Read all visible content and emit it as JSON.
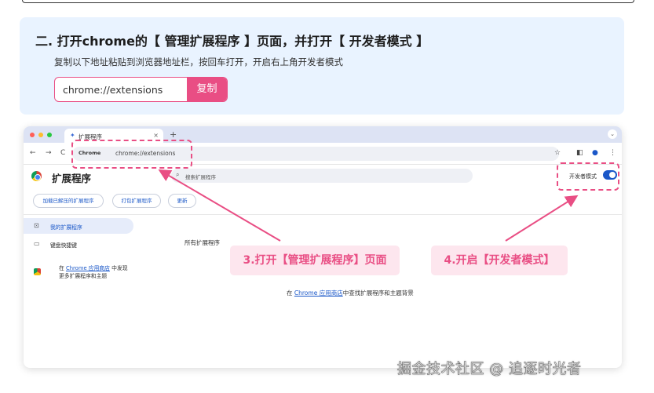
{
  "step": {
    "title": "二. 打开chrome的【 管理扩展程序 】页面，并打开【 开发者模式 】",
    "description": "复制以下地址粘贴到浏览器地址栏，按回车打开，开启右上角开发者模式",
    "url_value": "chrome://extensions",
    "copy_label": "复制"
  },
  "browser": {
    "tab_label": "扩展程序",
    "tab_close": "×",
    "new_tab": "+",
    "omnibox_chip": "Chrome",
    "omnibox_url": "chrome://extensions",
    "nav_back": "←",
    "nav_forward": "→",
    "nav_reload": "C"
  },
  "extensions_page": {
    "title": "扩展程序",
    "search_placeholder": "搜索扩展程序",
    "dev_mode_label": "开发者模式",
    "dev_mode_on": true,
    "buttons": [
      "加载已解压的扩展程序",
      "打包扩展程序",
      "更新"
    ],
    "sidebar": [
      {
        "label": "我的扩展程序",
        "active": true
      },
      {
        "label": "键盘快捷键",
        "active": false
      }
    ],
    "store_note_prefix": "在",
    "store_link": "Chrome 应用商店",
    "store_note_suffix": "中发现",
    "store_note_line2": "更多扩展程序和主题",
    "all_extensions_label": "所有扩展程序",
    "center_prefix": "在",
    "center_link": "Chrome 应用商店",
    "center_suffix": "中查找扩展程序和主题背景"
  },
  "callouts": {
    "manage": "3.打开【管理扩展程序】页面",
    "devmode": "4.开启【开发者模式】"
  },
  "watermark": "掘金技术社区 @ 追逐时光者",
  "colors": {
    "accent": "#e94e84",
    "card_bg": "#e9f3ff",
    "link": "#1a57c8"
  }
}
